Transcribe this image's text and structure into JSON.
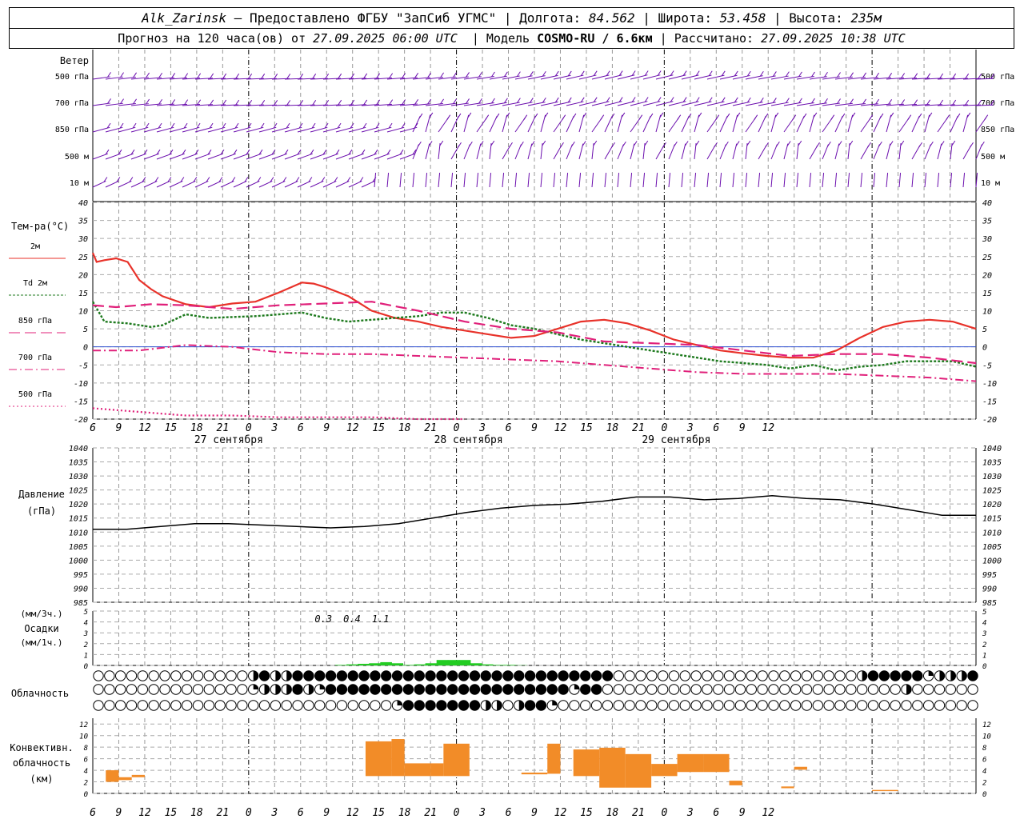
{
  "header": {
    "station": "Alk_Zarinsk",
    "provider": "Предоставлено ФГБУ \"ЗапСиб УГМС\"",
    "lon_label": "Долгота:",
    "lon": "84.562",
    "lat_label": "Широта:",
    "lat": "53.458",
    "alt_label": "Высота:",
    "alt": "235м",
    "forecast_prefix": "Прогноз на 120 часа(ов) от",
    "forecast_time": "27.09.2025 06:00 UTC",
    "model_label": "Модель",
    "model": "COSMO-RU / 6.6км",
    "calc_label": "Рассчитано:",
    "calc_time": "27.09.2025 10:38 UTC"
  },
  "time_axis": {
    "hour_ticks": [
      "6",
      "9",
      "12",
      "15",
      "18",
      "21",
      "0",
      "3",
      "6",
      "9",
      "12",
      "15",
      "18",
      "21",
      "0",
      "3",
      "6",
      "9",
      "12",
      "15",
      "18",
      "21",
      "0",
      "3",
      "6",
      "9",
      "12"
    ],
    "day_labels": [
      "27 сентября",
      "28 сентября",
      "29 сентября"
    ]
  },
  "wind_panel": {
    "title": "Ветер",
    "levels": [
      "500 гПа",
      "700 гПа",
      "850 гПа",
      "500 м",
      "10  м"
    ],
    "color": "#6a0dad"
  },
  "temp_panel": {
    "title": "Тем-ра(°С)",
    "legend": [
      {
        "label": "2м",
        "color": "#e8322a"
      },
      {
        "label": "Td  2м",
        "color": "#1e7a1e"
      },
      {
        "label": "850 гПа",
        "color": "#e0207a"
      },
      {
        "label": "700 гПа",
        "color": "#e0207a"
      },
      {
        "label": "500 гПа",
        "color": "#e0207a"
      }
    ],
    "y_ticks": [
      "40",
      "35",
      "30",
      "25",
      "20",
      "15",
      "10",
      "5",
      "0",
      "-5",
      "-10",
      "-15",
      "-20"
    ]
  },
  "pressure_panel": {
    "title": "Давление",
    "unit": "(гПа)",
    "y_ticks": [
      "1040",
      "1035",
      "1030",
      "1025",
      "1020",
      "1015",
      "1010",
      "1005",
      "1000",
      "995",
      "990",
      "985"
    ]
  },
  "precip_panel": {
    "unit_3h": "(мм/3ч.)",
    "title": "Осадки",
    "unit_1h": "(мм/1ч.)",
    "y_ticks": [
      "5",
      "4",
      "3",
      "2",
      "1",
      "0"
    ],
    "totals": [
      {
        "hour": 9,
        "text": "0.3"
      },
      {
        "hour": 12,
        "text": "0.4"
      },
      {
        "hour": 15,
        "text": "1.1"
      }
    ],
    "color": "#22cc22"
  },
  "cloud_panel": {
    "title": "Облачность"
  },
  "conv_panel": {
    "title1": "Конвективн.",
    "title2": "облачность",
    "unit": "(км)",
    "y_ticks": [
      "12",
      "10",
      "8",
      "6",
      "4",
      "2",
      "0"
    ],
    "color": "#f28c28"
  },
  "chart_data": [
    {
      "type": "line",
      "title": "Тем-ра(°С)",
      "x_hours_from_start": "0..102",
      "x_start": "27.09.2025 06 UTC",
      "ylim": [
        -20,
        40
      ],
      "series": [
        {
          "name": "2м",
          "values": [
            [
              0,
              26
            ],
            [
              1,
              23.5
            ],
            [
              3,
              24
            ],
            [
              6,
              24.5
            ],
            [
              9,
              23.5
            ],
            [
              12,
              18.5
            ],
            [
              15,
              16
            ],
            [
              18,
              14
            ],
            [
              24,
              11.8
            ],
            [
              30,
              11
            ],
            [
              36,
              12
            ],
            [
              42,
              12.5
            ],
            [
              48,
              15
            ],
            [
              54,
              17.8
            ],
            [
              57,
              17.5
            ],
            [
              60,
              16.5
            ],
            [
              66,
              14
            ],
            [
              72,
              10
            ],
            [
              78,
              8
            ],
            [
              84,
              7
            ],
            [
              90,
              5.5
            ],
            [
              96,
              4.5
            ],
            [
              102,
              3.5
            ],
            [
              108,
              2.5
            ],
            [
              114,
              3
            ],
            [
              120,
              5
            ],
            [
              126,
              7
            ],
            [
              132,
              7.5
            ],
            [
              138,
              6.5
            ],
            [
              144,
              4.5
            ],
            [
              150,
              2
            ],
            [
              156,
              0.5
            ],
            [
              162,
              -1
            ],
            [
              168,
              -1.8
            ],
            [
              174,
              -2.5
            ],
            [
              180,
              -3
            ],
            [
              186,
              -3
            ],
            [
              192,
              -1
            ],
            [
              198,
              2.5
            ],
            [
              204,
              5.5
            ],
            [
              210,
              7
            ],
            [
              216,
              7.5
            ],
            [
              222,
              7
            ],
            [
              228,
              5
            ]
          ]
        },
        {
          "name": "Td  2м",
          "values": [
            [
              0,
              12.5
            ],
            [
              3,
              7
            ],
            [
              9,
              6.5
            ],
            [
              15,
              5.5
            ],
            [
              18,
              6
            ],
            [
              24,
              9
            ],
            [
              30,
              8
            ],
            [
              42,
              8.5
            ],
            [
              54,
              9.5
            ],
            [
              60,
              8
            ],
            [
              66,
              7
            ],
            [
              72,
              7.5
            ],
            [
              78,
              8
            ],
            [
              84,
              8.5
            ],
            [
              90,
              9.5
            ],
            [
              96,
              9.5
            ],
            [
              102,
              8
            ],
            [
              108,
              6
            ],
            [
              114,
              5
            ],
            [
              120,
              3.5
            ],
            [
              126,
              2
            ],
            [
              132,
              1
            ],
            [
              138,
              0
            ],
            [
              150,
              -2
            ],
            [
              162,
              -4
            ],
            [
              174,
              -5
            ],
            [
              180,
              -6
            ],
            [
              186,
              -5
            ],
            [
              192,
              -6.5
            ],
            [
              198,
              -5.5
            ],
            [
              204,
              -5
            ],
            [
              210,
              -4
            ],
            [
              216,
              -4
            ],
            [
              222,
              -4
            ],
            [
              228,
              -5.5
            ]
          ]
        },
        {
          "name": "850 гПа",
          "values": [
            [
              0,
              11.5
            ],
            [
              6,
              11
            ],
            [
              15,
              11.8
            ],
            [
              24,
              11.5
            ],
            [
              36,
              10.5
            ],
            [
              48,
              11.5
            ],
            [
              60,
              12
            ],
            [
              72,
              12.5
            ],
            [
              84,
              10
            ],
            [
              96,
              7
            ],
            [
              108,
              5
            ],
            [
              120,
              4
            ],
            [
              132,
              1.5
            ],
            [
              144,
              1
            ],
            [
              156,
              0.5
            ],
            [
              168,
              -1
            ],
            [
              180,
              -2.5
            ],
            [
              192,
              -2
            ],
            [
              204,
              -2
            ],
            [
              216,
              -3
            ],
            [
              228,
              -4.5
            ]
          ]
        },
        {
          "name": "700 гПа",
          "values": [
            [
              0,
              -1
            ],
            [
              12,
              -1
            ],
            [
              24,
              0.5
            ],
            [
              36,
              0
            ],
            [
              48,
              -1.5
            ],
            [
              60,
              -2
            ],
            [
              72,
              -2
            ],
            [
              84,
              -2.5
            ],
            [
              96,
              -3
            ],
            [
              108,
              -3.5
            ],
            [
              120,
              -4
            ],
            [
              132,
              -5
            ],
            [
              144,
              -6
            ],
            [
              156,
              -7
            ],
            [
              168,
              -7.5
            ],
            [
              180,
              -7.5
            ],
            [
              192,
              -7.5
            ],
            [
              204,
              -8
            ],
            [
              216,
              -8.5
            ],
            [
              228,
              -9.5
            ]
          ]
        },
        {
          "name": "500 гПа",
          "values": [
            [
              0,
              -17
            ],
            [
              12,
              -18
            ],
            [
              24,
              -19
            ],
            [
              36,
              -19
            ],
            [
              48,
              -19.5
            ],
            [
              60,
              -19.5
            ],
            [
              72,
              -19.5
            ],
            [
              84,
              -20
            ],
            [
              96,
              -20
            ]
          ]
        }
      ]
    },
    {
      "type": "line",
      "title": "Давление",
      "ylim": [
        985,
        1040
      ],
      "series": [
        {
          "name": "Давление",
          "values": [
            [
              0,
              1011
            ],
            [
              6,
              1011
            ],
            [
              12,
              1011
            ],
            [
              24,
              1012
            ],
            [
              36,
              1013
            ],
            [
              48,
              1013
            ],
            [
              60,
              1012.5
            ],
            [
              72,
              1012
            ],
            [
              84,
              1011.5
            ],
            [
              96,
              1012
            ],
            [
              108,
              1013
            ],
            [
              120,
              1015
            ],
            [
              132,
              1017
            ],
            [
              144,
              1018.5
            ],
            [
              156,
              1019.5
            ],
            [
              168,
              1020
            ],
            [
              180,
              1021
            ],
            [
              192,
              1022.5
            ],
            [
              204,
              1022.5
            ],
            [
              216,
              1021.5
            ],
            [
              228,
              1022
            ],
            [
              240,
              1023
            ],
            [
              252,
              1022
            ],
            [
              264,
              1021.5
            ],
            [
              276,
              1020
            ],
            [
              288,
              1018
            ],
            [
              300,
              1016
            ],
            [
              312,
              1016
            ]
          ]
        }
      ]
    },
    {
      "type": "bar",
      "title": "Осадки",
      "ylim": [
        0,
        5
      ],
      "x": [
        50,
        51,
        52,
        53,
        54,
        55,
        56,
        57,
        58,
        59,
        60,
        61,
        62,
        63,
        64,
        65,
        66
      ],
      "values": [
        0.05,
        0.1,
        0.15,
        0.2,
        0.3,
        0.2,
        0.05,
        0.1,
        0.2,
        0.5,
        0.5,
        0.5,
        0.2,
        0.1,
        0.05,
        0.05,
        0.02
      ]
    },
    {
      "type": "bar",
      "title": "Конвективн. облачность",
      "ylim": [
        0,
        13
      ],
      "bars": [
        {
          "x0": 1,
          "x1": 2,
          "bottom": 2,
          "top": 4
        },
        {
          "x0": 2,
          "x1": 3,
          "bottom": 2.3,
          "top": 2.8
        },
        {
          "x0": 3,
          "x1": 4,
          "bottom": 2.8,
          "top": 3.2
        },
        {
          "x0": 21,
          "x1": 23,
          "bottom": 3,
          "top": 9
        },
        {
          "x0": 23,
          "x1": 24,
          "bottom": 3,
          "top": 9.4
        },
        {
          "x0": 24,
          "x1": 26,
          "bottom": 3,
          "top": 5.2
        },
        {
          "x0": 26,
          "x1": 27,
          "bottom": 3,
          "top": 5.2
        },
        {
          "x0": 27,
          "x1": 29,
          "bottom": 3,
          "top": 8.6
        },
        {
          "x0": 33,
          "x1": 35,
          "bottom": 3.3,
          "top": 3.6
        },
        {
          "x0": 35,
          "x1": 36,
          "bottom": 3.4,
          "top": 8.6
        },
        {
          "x0": 37,
          "x1": 39,
          "bottom": 3,
          "top": 7.6
        },
        {
          "x0": 39,
          "x1": 41,
          "bottom": 1,
          "top": 7.9
        },
        {
          "x0": 41,
          "x1": 43,
          "bottom": 1,
          "top": 6.8
        },
        {
          "x0": 43,
          "x1": 45,
          "bottom": 3,
          "top": 5.1
        },
        {
          "x0": 45,
          "x1": 47,
          "bottom": 3.7,
          "top": 6.8
        },
        {
          "x0": 47,
          "x1": 49,
          "bottom": 3.7,
          "top": 6.8
        },
        {
          "x0": 49,
          "x1": 50,
          "bottom": 1.4,
          "top": 2.2
        },
        {
          "x0": 53,
          "x1": 54,
          "bottom": 0.9,
          "top": 1.2
        },
        {
          "x0": 54,
          "x1": 55,
          "bottom": 4.1,
          "top": 4.6
        },
        {
          "x0": 60,
          "x1": 62,
          "bottom": 0.4,
          "top": 0.6
        }
      ]
    }
  ]
}
